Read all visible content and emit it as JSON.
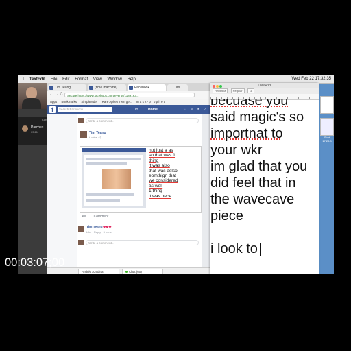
{
  "menubar": {
    "apple": "",
    "app": "TextEdit",
    "items": [
      "File",
      "Edit",
      "Format",
      "View",
      "Window",
      "Help"
    ],
    "right": "Wed Feb 22  17:32:35"
  },
  "call": {
    "label": "Current Call",
    "name": "Parches",
    "time": "03:21"
  },
  "browser": {
    "tabs": [
      "Tim Teang",
      "(time machine)",
      "Facebook",
      "Tim"
    ],
    "nav": "← → C",
    "url": "Secure  https://www.facebook.com/events/1189163...",
    "bookmarks": [
      "Apps",
      "Bookmarks",
      "SimpleMder",
      "Rare Aphex Twin ge...",
      "m a s k - p r o p h e t"
    ]
  },
  "facebook": {
    "search_placeholder": "Search Facebook",
    "user": "Tim",
    "home": "Home",
    "comment_placeholder": "Write a comment...",
    "post_author": "Tim Teang",
    "post_meta": "6 mins · ⚲",
    "inner_text": [
      "not just a as",
      "so that was 1",
      "thing",
      "it was also",
      "that was aslso",
      "eomthign that",
      "we considered",
      "as well",
      "1 thing",
      "it was nece"
    ],
    "actions": [
      "Like",
      "Comment"
    ],
    "reply_name": "Tim Teang",
    "reply_hearts": "❤❤❤",
    "reply_meta": "Like · Reply · 5 mins",
    "chat_pills": [
      "Andrés Azedina",
      "Chat (60)"
    ]
  },
  "textedit": {
    "title": "Untitled 2",
    "toolbar": [
      "Helvetica",
      "Regular",
      "18"
    ],
    "lines": [
      "becuase you",
      "said magic's so",
      "importnat to",
      "your wkr",
      "im glad that you",
      "did feel that in",
      "the wavecave",
      "piece",
      "",
      "i look to"
    ]
  },
  "desktop": {
    "file_label": "Shot 17.23.3"
  },
  "timecode": "00:03:07;00"
}
